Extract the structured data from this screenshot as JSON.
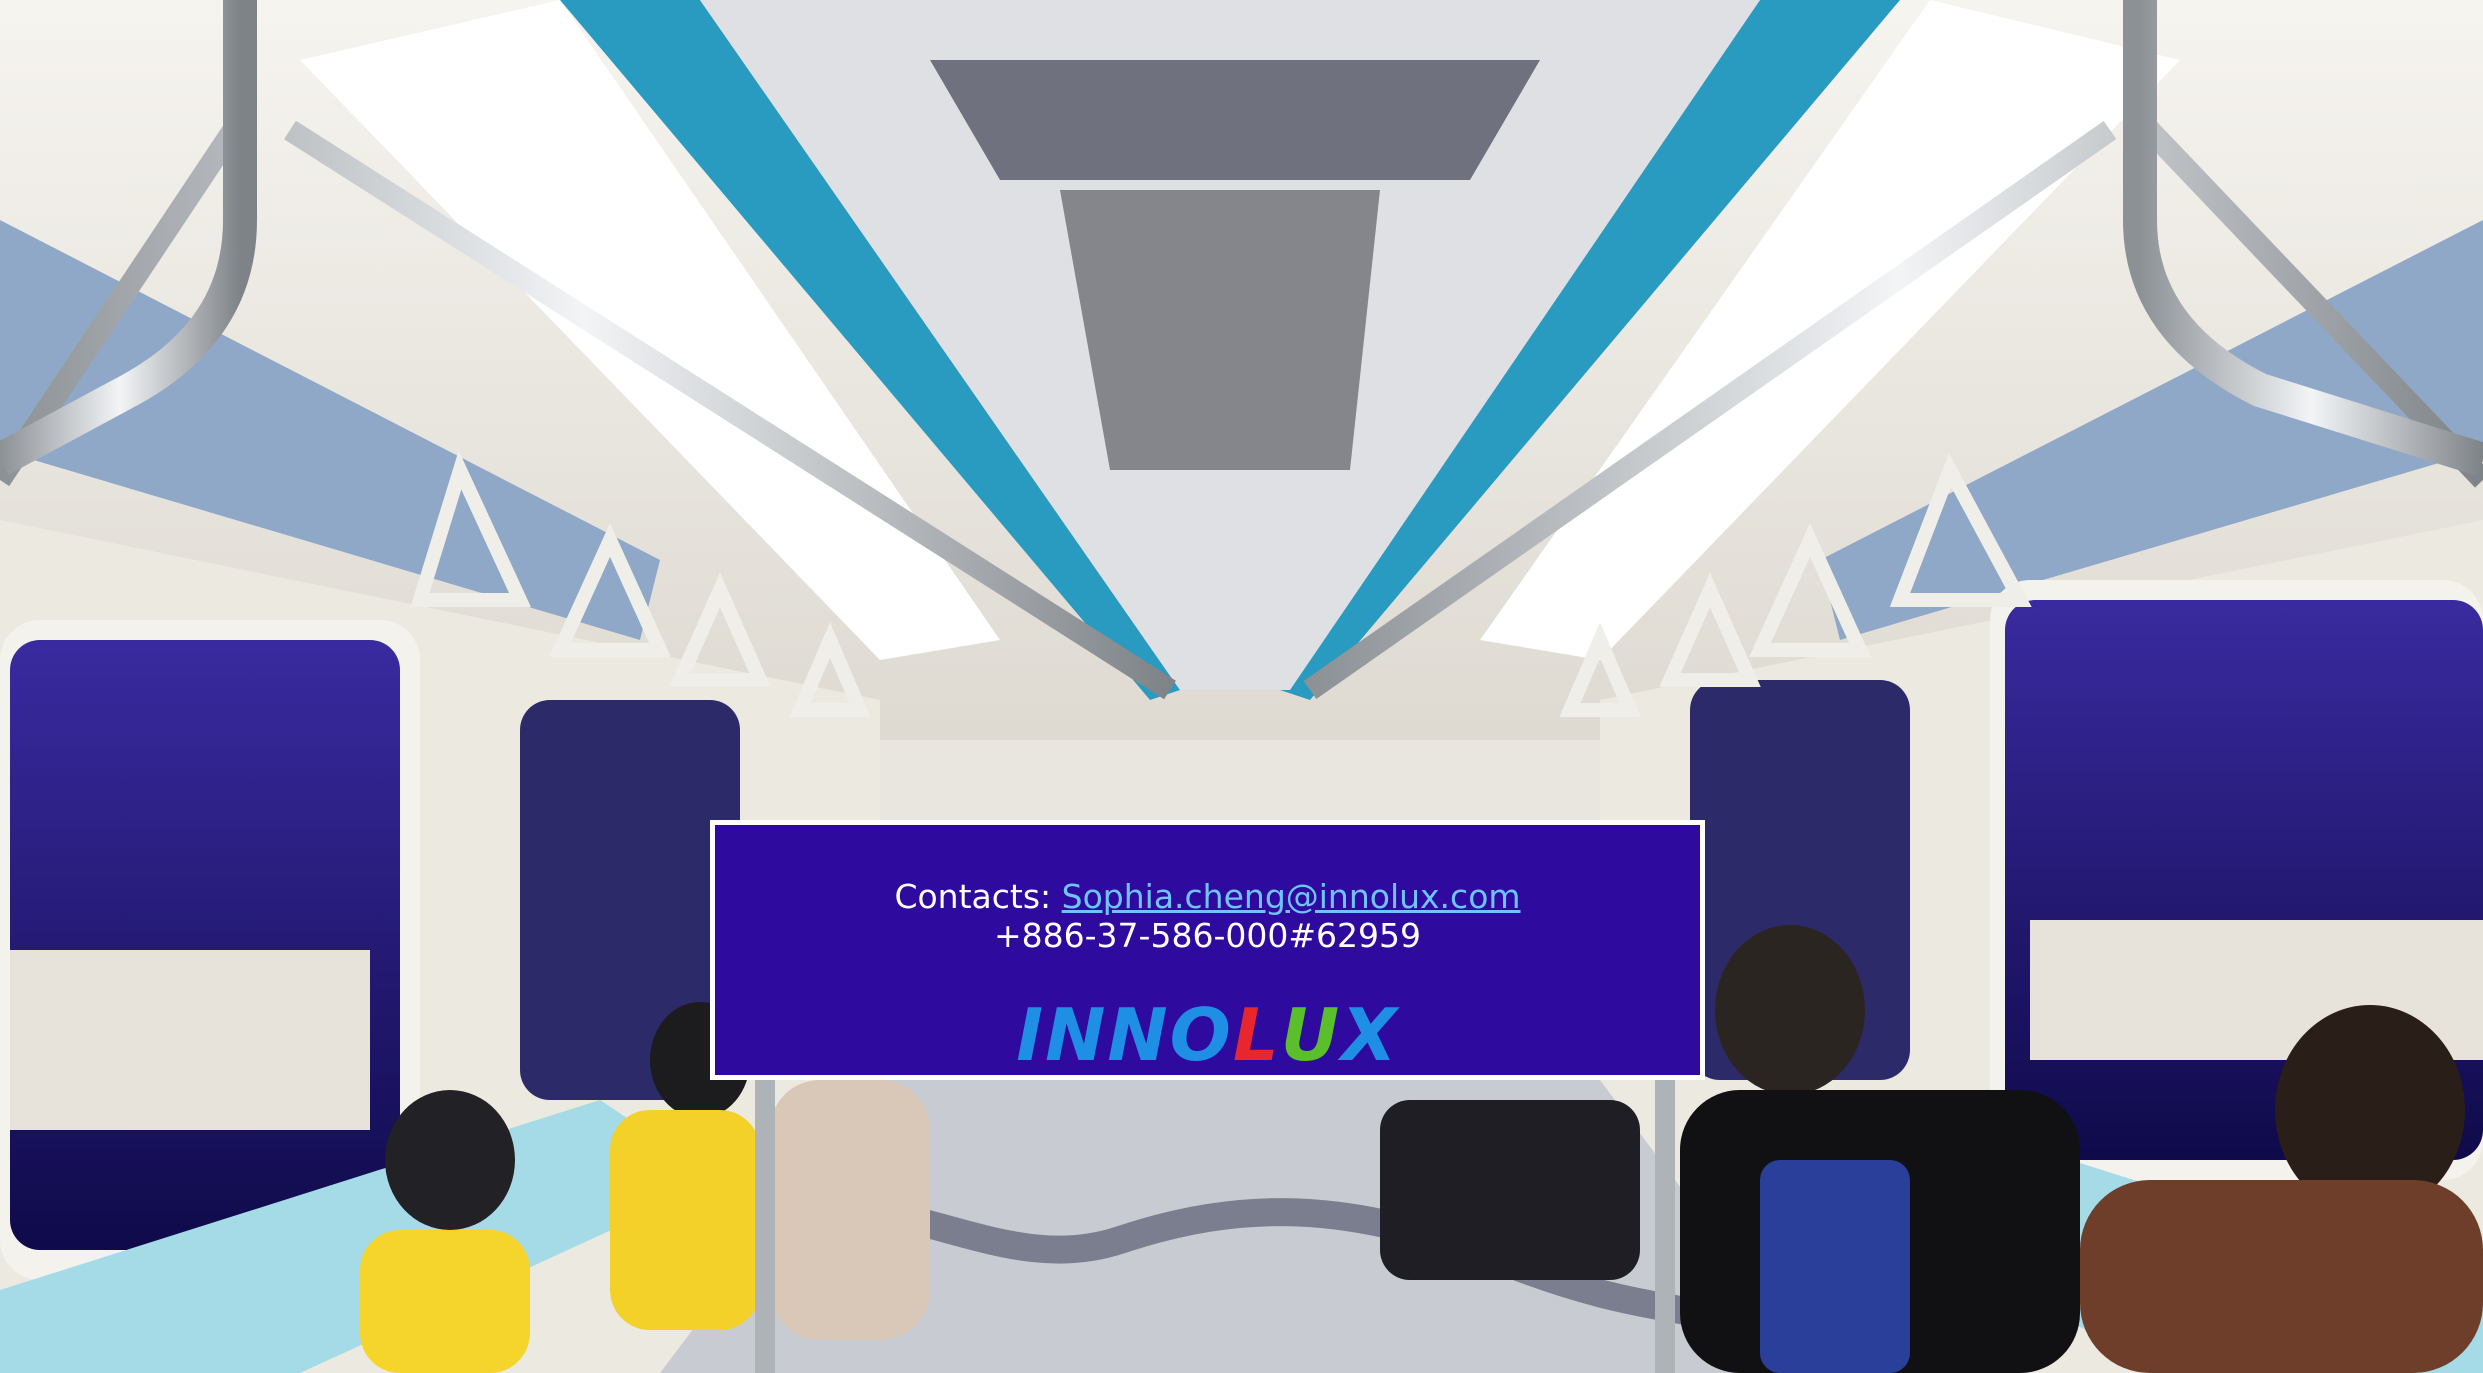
{
  "contact": {
    "label": "Contacts: ",
    "email": "Sophia.cheng@innolux.com",
    "phone": "+886-37-586-000#62959"
  },
  "logo": {
    "letters": [
      "I",
      "N",
      "N",
      "O",
      "L",
      "U",
      "X"
    ],
    "colors": [
      "#1f8fe6",
      "#1f8fe6",
      "#1f8fe6",
      "#1f8fe6",
      "#e8262d",
      "#5bbf2c",
      "#1f8fe6"
    ]
  },
  "colors": {
    "box_background": "#2e0a9e",
    "box_border": "#ffffff",
    "link": "#6fc3ff"
  }
}
